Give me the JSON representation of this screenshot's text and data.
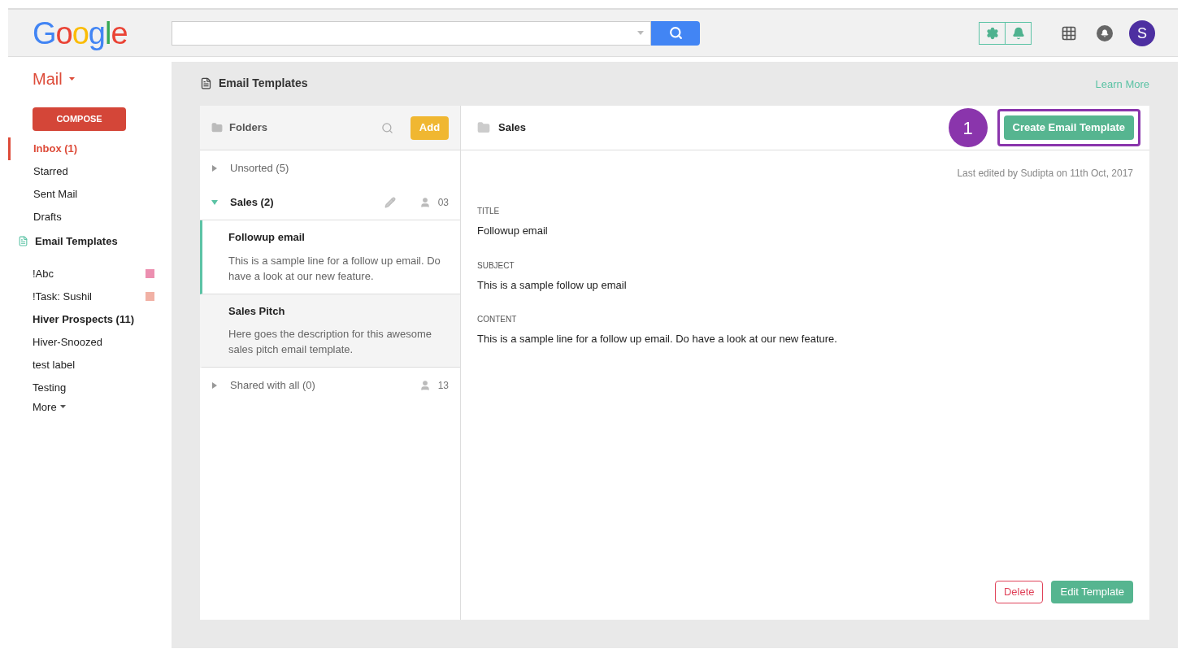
{
  "header": {
    "logo": "Google",
    "avatar": "S"
  },
  "sidebar": {
    "app": "Mail",
    "compose": "COMPOSE",
    "items": [
      {
        "label": "Inbox (1)",
        "selected": true
      },
      {
        "label": "Starred",
        "selected": false
      },
      {
        "label": "Sent Mail",
        "selected": false
      },
      {
        "label": "Drafts",
        "selected": false
      }
    ],
    "templates_link": "Email Templates",
    "labels": [
      {
        "label": "!Abc",
        "bold": false,
        "color": "#ec8fb0"
      },
      {
        "label": "!Task: Sushil",
        "bold": false,
        "color": "#f1b1a5"
      },
      {
        "label": "Hiver Prospects (11)",
        "bold": true
      },
      {
        "label": "Hiver-Snoozed",
        "bold": false
      },
      {
        "label": "test label",
        "bold": false
      },
      {
        "label": "Testing",
        "bold": false
      }
    ],
    "more": "More"
  },
  "page": {
    "title": "Email Templates",
    "learn_more": "Learn More"
  },
  "folders": {
    "title": "Folders",
    "add": "Add",
    "items": [
      {
        "name": "Unsorted (5)",
        "expanded": false
      },
      {
        "name": "Sales (2)",
        "expanded": true,
        "editable": true,
        "count": "03",
        "children": [
          {
            "title": "Followup email",
            "description": "This is a sample line for a follow up email. Do have a look at our new feature.",
            "selected": true
          },
          {
            "title": "Sales Pitch",
            "description": "Here goes the description for this awesome sales pitch email template.",
            "selected": false
          }
        ]
      },
      {
        "name": "Shared with all (0)",
        "expanded": false,
        "count": "13"
      }
    ]
  },
  "detail": {
    "folder": "Sales",
    "step": "1",
    "create": "Create Email Template",
    "last_edited": "Last edited by Sudipta on 11th Oct, 2017",
    "fields": [
      {
        "label": "TITLE",
        "value": "Followup email"
      },
      {
        "label": "SUBJECT",
        "value": "This is a sample follow up email"
      },
      {
        "label": "CONTENT",
        "value": "This is a sample line for a follow up email. Do have a look at our new feature."
      }
    ],
    "delete": "Delete",
    "edit": "Edit Template"
  }
}
